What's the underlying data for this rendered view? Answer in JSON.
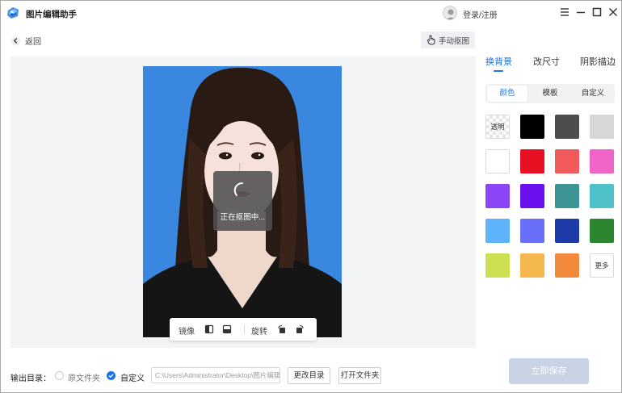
{
  "app": {
    "title": "图片编辑助手",
    "login_label": "登录/注册"
  },
  "toolbar": {
    "back_label": "返回",
    "manual_cutout_label": "手动抠图"
  },
  "canvas": {
    "loading_text": "正在抠图中..."
  },
  "image_tools": {
    "mirror_label": "镜像",
    "rotate_label": "旋转"
  },
  "right_panel": {
    "tabs": [
      "换背景",
      "改尺寸",
      "阴影描边"
    ],
    "active_tab": "换背景",
    "segments": [
      "颜色",
      "模板",
      "自定义"
    ],
    "active_segment": "颜色",
    "transparent_label": "透明",
    "more_label": "更多",
    "colors": [
      "transparent",
      "#000000",
      "#4d4d4d",
      "#d7d7d7",
      "#ffffff",
      "#e81123",
      "#f05a5a",
      "#f063c7",
      "#8b44f6",
      "#6a10ee",
      "#3c9497",
      "#4fc1ca",
      "#5eb3fa",
      "#6a6ffb",
      "#1d3ba8",
      "#2c862f",
      "#cde052",
      "#f5b84e",
      "#f28a3c",
      "more"
    ]
  },
  "bottom": {
    "output_label": "输出目录：",
    "option_source": "原文件夹",
    "option_custom": "自定义",
    "path_value": "C:\\Users\\Administrator\\Desktop\\图片编辑",
    "change_dir_label": "更改目录",
    "open_folder_label": "打开文件夹",
    "save_label": "立即保存"
  }
}
